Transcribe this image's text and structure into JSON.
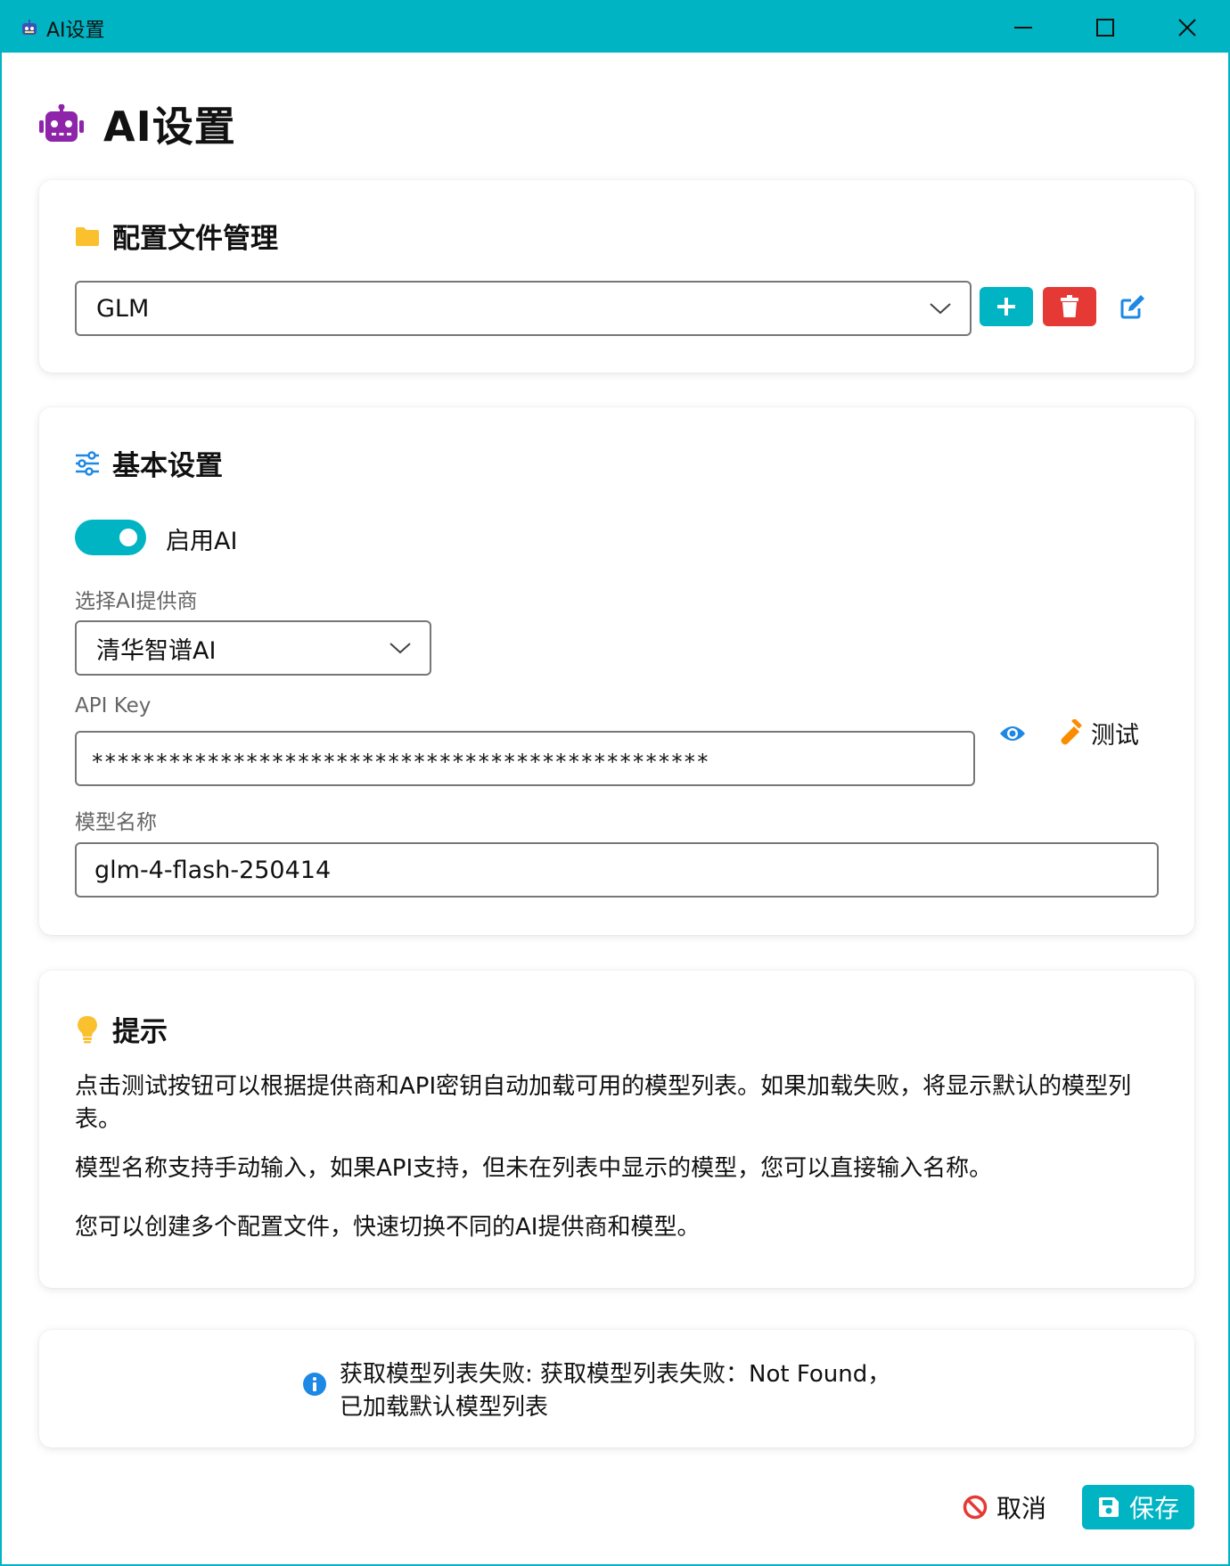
{
  "window": {
    "title": "AI设置"
  },
  "page": {
    "title": "AI设置"
  },
  "profile_section": {
    "title": "配置文件管理",
    "selected_profile": "GLM"
  },
  "basic_section": {
    "title": "基本设置",
    "enable_ai_label": "启用AI",
    "enable_ai": true,
    "provider_label": "选择AI提供商",
    "provider_value": "清华智谱AI",
    "api_key_label": "API Key",
    "api_key_value": "************************************************",
    "test_label": "测试",
    "model_label": "模型名称",
    "model_value": "glm-4-flash-250414"
  },
  "tips_section": {
    "title": "提示",
    "paragraphs": [
      "点击测试按钮可以根据提供商和API密钥自动加载可用的模型列表。如果加载失败，将显示默认的模型列表。",
      "模型名称支持手动输入，如果API支持，但未在列表中显示的模型，您可以直接输入名称。",
      "您可以创建多个配置文件，快速切换不同的AI提供商和模型。"
    ]
  },
  "status": {
    "line1": "获取模型列表失败: 获取模型列表失败：Not Found，",
    "line2": "已加载默认模型列表"
  },
  "footer": {
    "cancel_label": "取消",
    "save_label": "保存"
  },
  "colors": {
    "accent": "#00b4c4",
    "danger": "#e53935",
    "edit_blue": "#1e88e5",
    "robot_purple": "#8e24aa",
    "folder_yellow": "#fbc02d",
    "bulb_yellow": "#fbc02d",
    "test_orange": "#fb8c00",
    "info_blue": "#1e88e5"
  }
}
